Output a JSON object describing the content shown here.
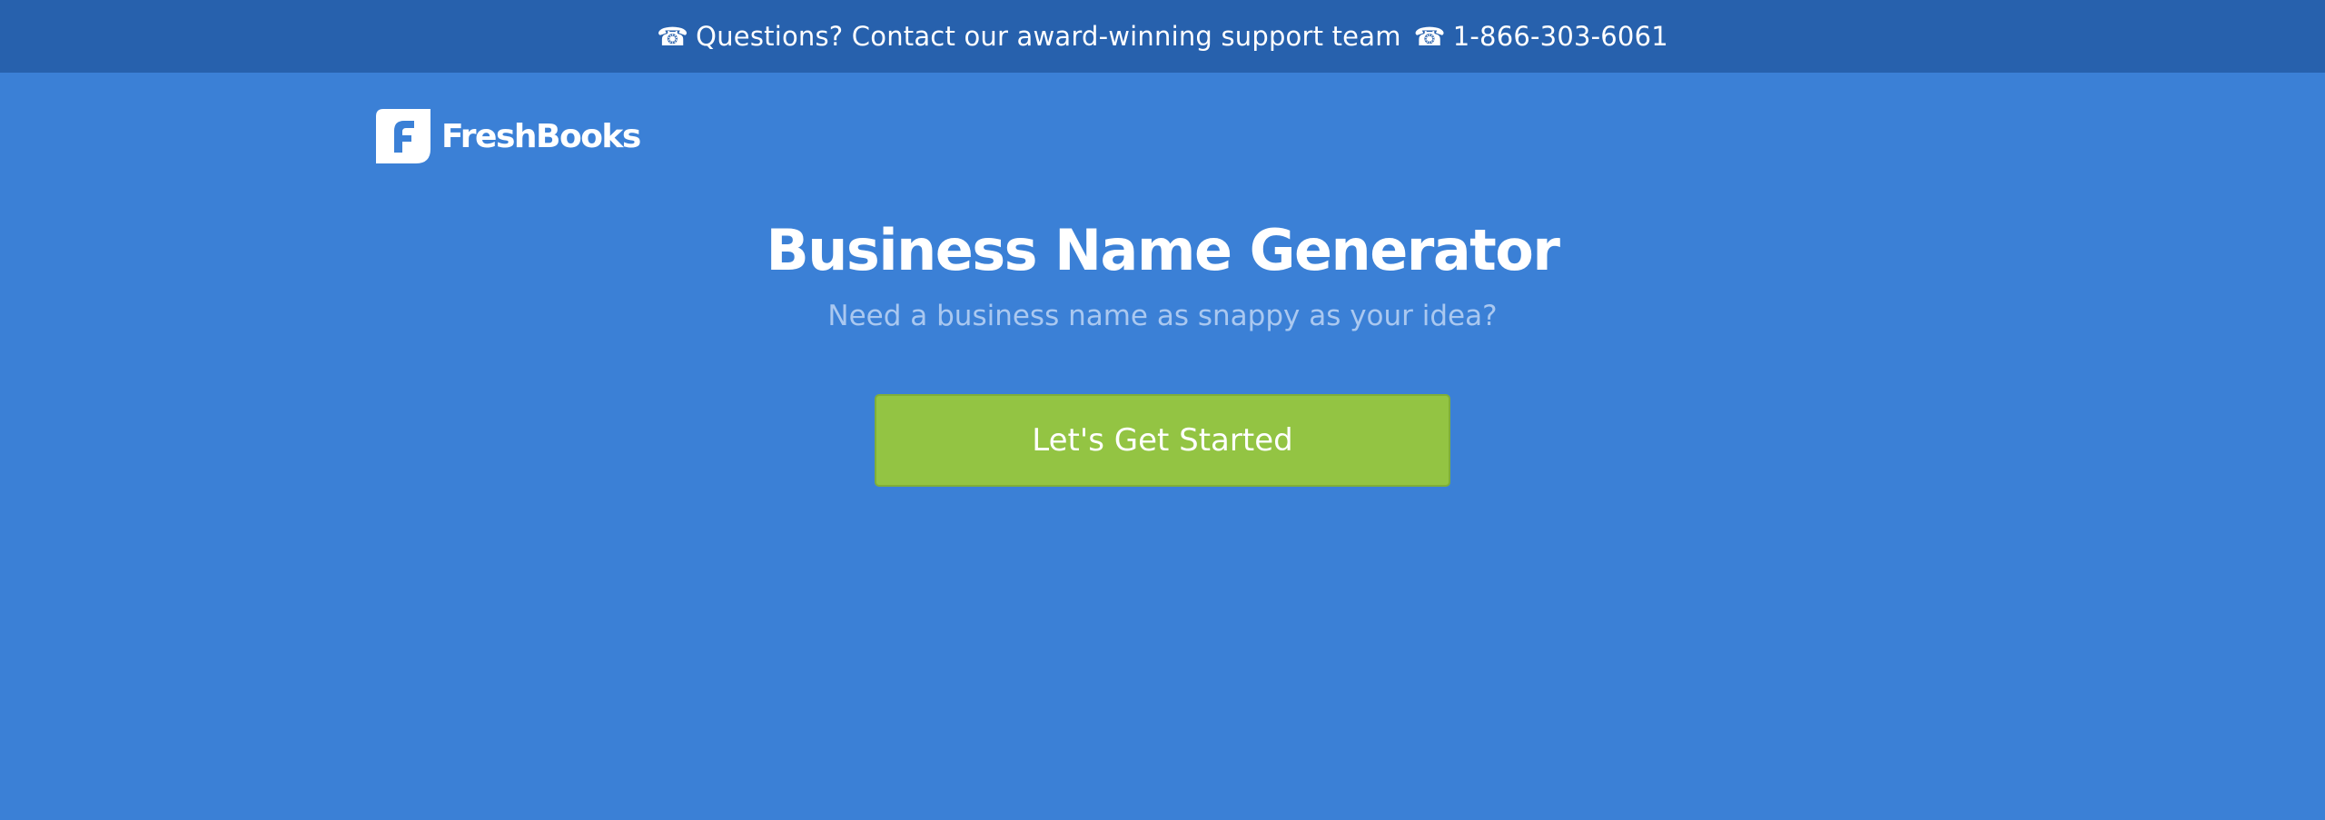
{
  "topbar": {
    "support_icon": "phone-icon",
    "support_text": "Questions? Contact our award-winning support team",
    "phone_icon": "phone-icon",
    "phone_number": "1-866-303-6061",
    "icon_glyph": "☎",
    "background_color": "#2761ad"
  },
  "brand": {
    "name": "FreshBooks",
    "logo_icon": "freshbooks-logo-icon"
  },
  "hero": {
    "title": "Business Name Generator",
    "subtitle": "Need a business name as snappy as your idea?",
    "cta_label": "Let's Get Started",
    "background_color": "#3b80d6",
    "cta_color": "#93c443",
    "subtitle_color": "#aac8f0"
  }
}
